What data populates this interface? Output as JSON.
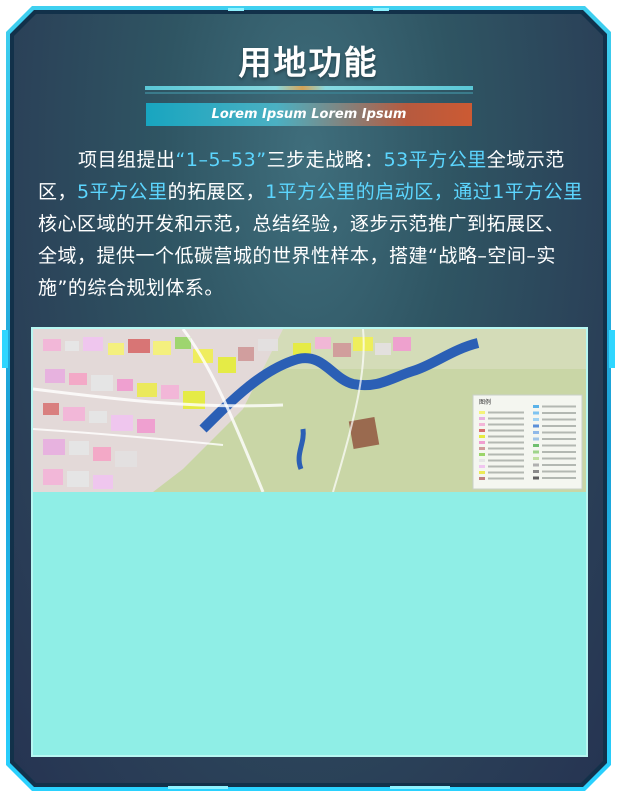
{
  "title": "用地功能",
  "subtitle": "Lorem Ipsum Lorem Ipsum",
  "paragraph": [
    {
      "text": "项目组提出",
      "hl": false
    },
    {
      "text": "“1–5–53”",
      "hl": true
    },
    {
      "text": "三步走战略：",
      "hl": false
    },
    {
      "text": "53平方公里",
      "hl": true
    },
    {
      "text": "全域示范区，",
      "hl": false
    },
    {
      "text": "5平方公里",
      "hl": true
    },
    {
      "text": "的拓展区，",
      "hl": false
    },
    {
      "text": "1平方公里的启动区，通过1平方公里",
      "hl": true
    },
    {
      "text": "核心区域的开发和示范，总结经验，逐步示范推广到拓展区、全域，提供一个低碳营城的世界性样本，搭建“战略–空间–实施”的综合规划体系。",
      "hl": false
    }
  ],
  "map": {
    "legend_title": "图例"
  },
  "colors": {
    "highlight": "#5cd6ff",
    "frame": "#2fd6ff",
    "panel": "#2f5563",
    "image_bg": "#8feee6"
  }
}
